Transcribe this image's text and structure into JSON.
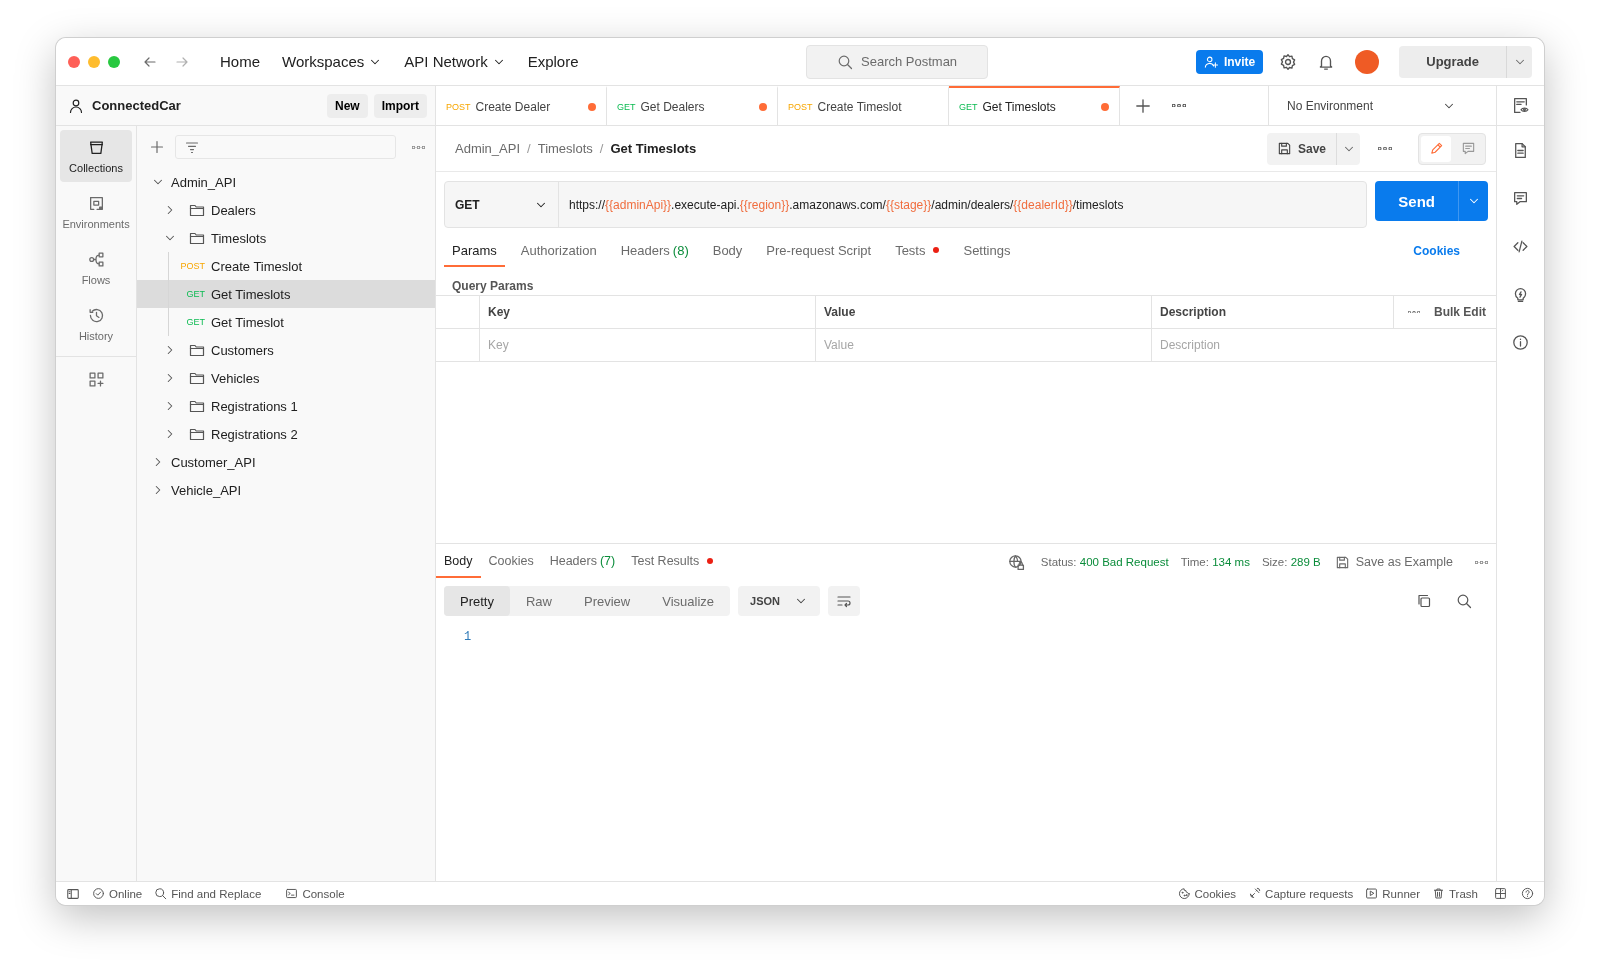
{
  "top_nav": {
    "links": [
      {
        "label": "Home",
        "dropdown": false
      },
      {
        "label": "Workspaces",
        "dropdown": true
      },
      {
        "label": "API Network",
        "dropdown": true
      },
      {
        "label": "Explore",
        "dropdown": false
      }
    ],
    "search": {
      "placeholder": "Search Postman"
    },
    "invite": "Invite",
    "upgrade": "Upgrade"
  },
  "workspace": {
    "name": "ConnectedCar",
    "buttons": [
      "New",
      "Import"
    ]
  },
  "nav_rail": [
    {
      "label": "Collections",
      "selected": true
    },
    {
      "label": "Environments",
      "selected": false
    },
    {
      "label": "Flows",
      "selected": false
    },
    {
      "label": "History",
      "selected": false
    }
  ],
  "tabs": [
    {
      "method": "POST",
      "title": "Create Dealer",
      "unsaved": true,
      "selected": false
    },
    {
      "method": "GET",
      "title": "Get Dealers",
      "unsaved": true,
      "selected": false
    },
    {
      "method": "POST",
      "title": "Create Timeslot",
      "unsaved": false,
      "selected": false
    },
    {
      "method": "GET",
      "title": "Get Timeslots",
      "unsaved": true,
      "selected": true
    }
  ],
  "environment": "No Environment",
  "sidebar": {
    "tree": [
      {
        "kind": "collection",
        "label": "Admin_API",
        "expanded": true,
        "children": [
          {
            "kind": "folder",
            "label": "Dealers",
            "expanded": false
          },
          {
            "kind": "folder",
            "label": "Timeslots",
            "expanded": true,
            "children": [
              {
                "kind": "request",
                "method": "POST",
                "label": "Create Timeslot",
                "selected": false
              },
              {
                "kind": "request",
                "method": "GET",
                "label": "Get Timeslots",
                "selected": true
              },
              {
                "kind": "request",
                "method": "GET",
                "label": "Get Timeslot",
                "selected": false
              }
            ]
          },
          {
            "kind": "folder",
            "label": "Customers",
            "expanded": false
          },
          {
            "kind": "folder",
            "label": "Vehicles",
            "expanded": false
          },
          {
            "kind": "folder",
            "label": "Registrations 1",
            "expanded": false
          },
          {
            "kind": "folder",
            "label": "Registrations 2",
            "expanded": false
          }
        ]
      },
      {
        "kind": "collection",
        "label": "Customer_API",
        "expanded": false
      },
      {
        "kind": "collection",
        "label": "Vehicle_API",
        "expanded": false
      }
    ]
  },
  "request": {
    "breadcrumb": [
      {
        "label": "Admin_API",
        "separator": "/"
      },
      {
        "label": "Timeslots",
        "separator": "/"
      },
      {
        "label": "Get Timeslots"
      }
    ],
    "save": "Save",
    "method": "GET",
    "url_parts": [
      {
        "text": "https://",
        "variable": false
      },
      {
        "text": "{{adminApi}}",
        "variable": true
      },
      {
        "text": ".execute-api.",
        "variable": false
      },
      {
        "text": "{{region}}",
        "variable": true
      },
      {
        "text": ".amazonaws.com/",
        "variable": false
      },
      {
        "text": "{{stage}}",
        "variable": true
      },
      {
        "text": "/admin/dealers/",
        "variable": false
      },
      {
        "text": "{{dealerId}}",
        "variable": true
      },
      {
        "text": "/timeslots",
        "variable": false
      }
    ],
    "send": "Send",
    "tabs": [
      {
        "label": "Params",
        "selected": true,
        "dot": false
      },
      {
        "label": "Authorization",
        "selected": false,
        "dot": false
      },
      {
        "label": "Headers",
        "count": "(8)",
        "selected": false,
        "dot": false
      },
      {
        "label": "Body",
        "selected": false,
        "dot": false
      },
      {
        "label": "Pre-request Script",
        "selected": false,
        "dot": false
      },
      {
        "label": "Tests",
        "selected": false,
        "dot": true
      },
      {
        "label": "Settings",
        "selected": false,
        "dot": false
      }
    ],
    "cookies": "Cookies",
    "query_params": {
      "title": "Query Params",
      "columns": [
        "Key",
        "Value",
        "Description"
      ],
      "bulk_edit": "Bulk Edit",
      "placeholders": [
        "Key",
        "Value",
        "Description"
      ]
    }
  },
  "response": {
    "tabs": [
      {
        "label": "Body",
        "selected": true,
        "dot": false
      },
      {
        "label": "Cookies",
        "selected": false,
        "dot": false
      },
      {
        "label": "Headers",
        "count": "(7)",
        "selected": false,
        "dot": false
      },
      {
        "label": "Test Results",
        "selected": false,
        "dot": true
      }
    ],
    "meta": [
      {
        "label": "Status:",
        "value": "400 Bad Request"
      },
      {
        "label": "Time:",
        "value": "134 ms"
      },
      {
        "label": "Size:",
        "value": "289 B"
      }
    ],
    "save_example": "Save as Example",
    "views": [
      {
        "label": "Pretty",
        "selected": true
      },
      {
        "label": "Raw",
        "selected": false
      },
      {
        "label": "Preview",
        "selected": false
      },
      {
        "label": "Visualize",
        "selected": false
      }
    ],
    "format": "JSON",
    "line_numbers": [
      "1"
    ]
  },
  "status_bar": {
    "left": [
      "Online",
      "Find and Replace",
      "Console"
    ],
    "right": [
      "Cookies",
      "Capture requests",
      "Runner",
      "Trash"
    ]
  }
}
